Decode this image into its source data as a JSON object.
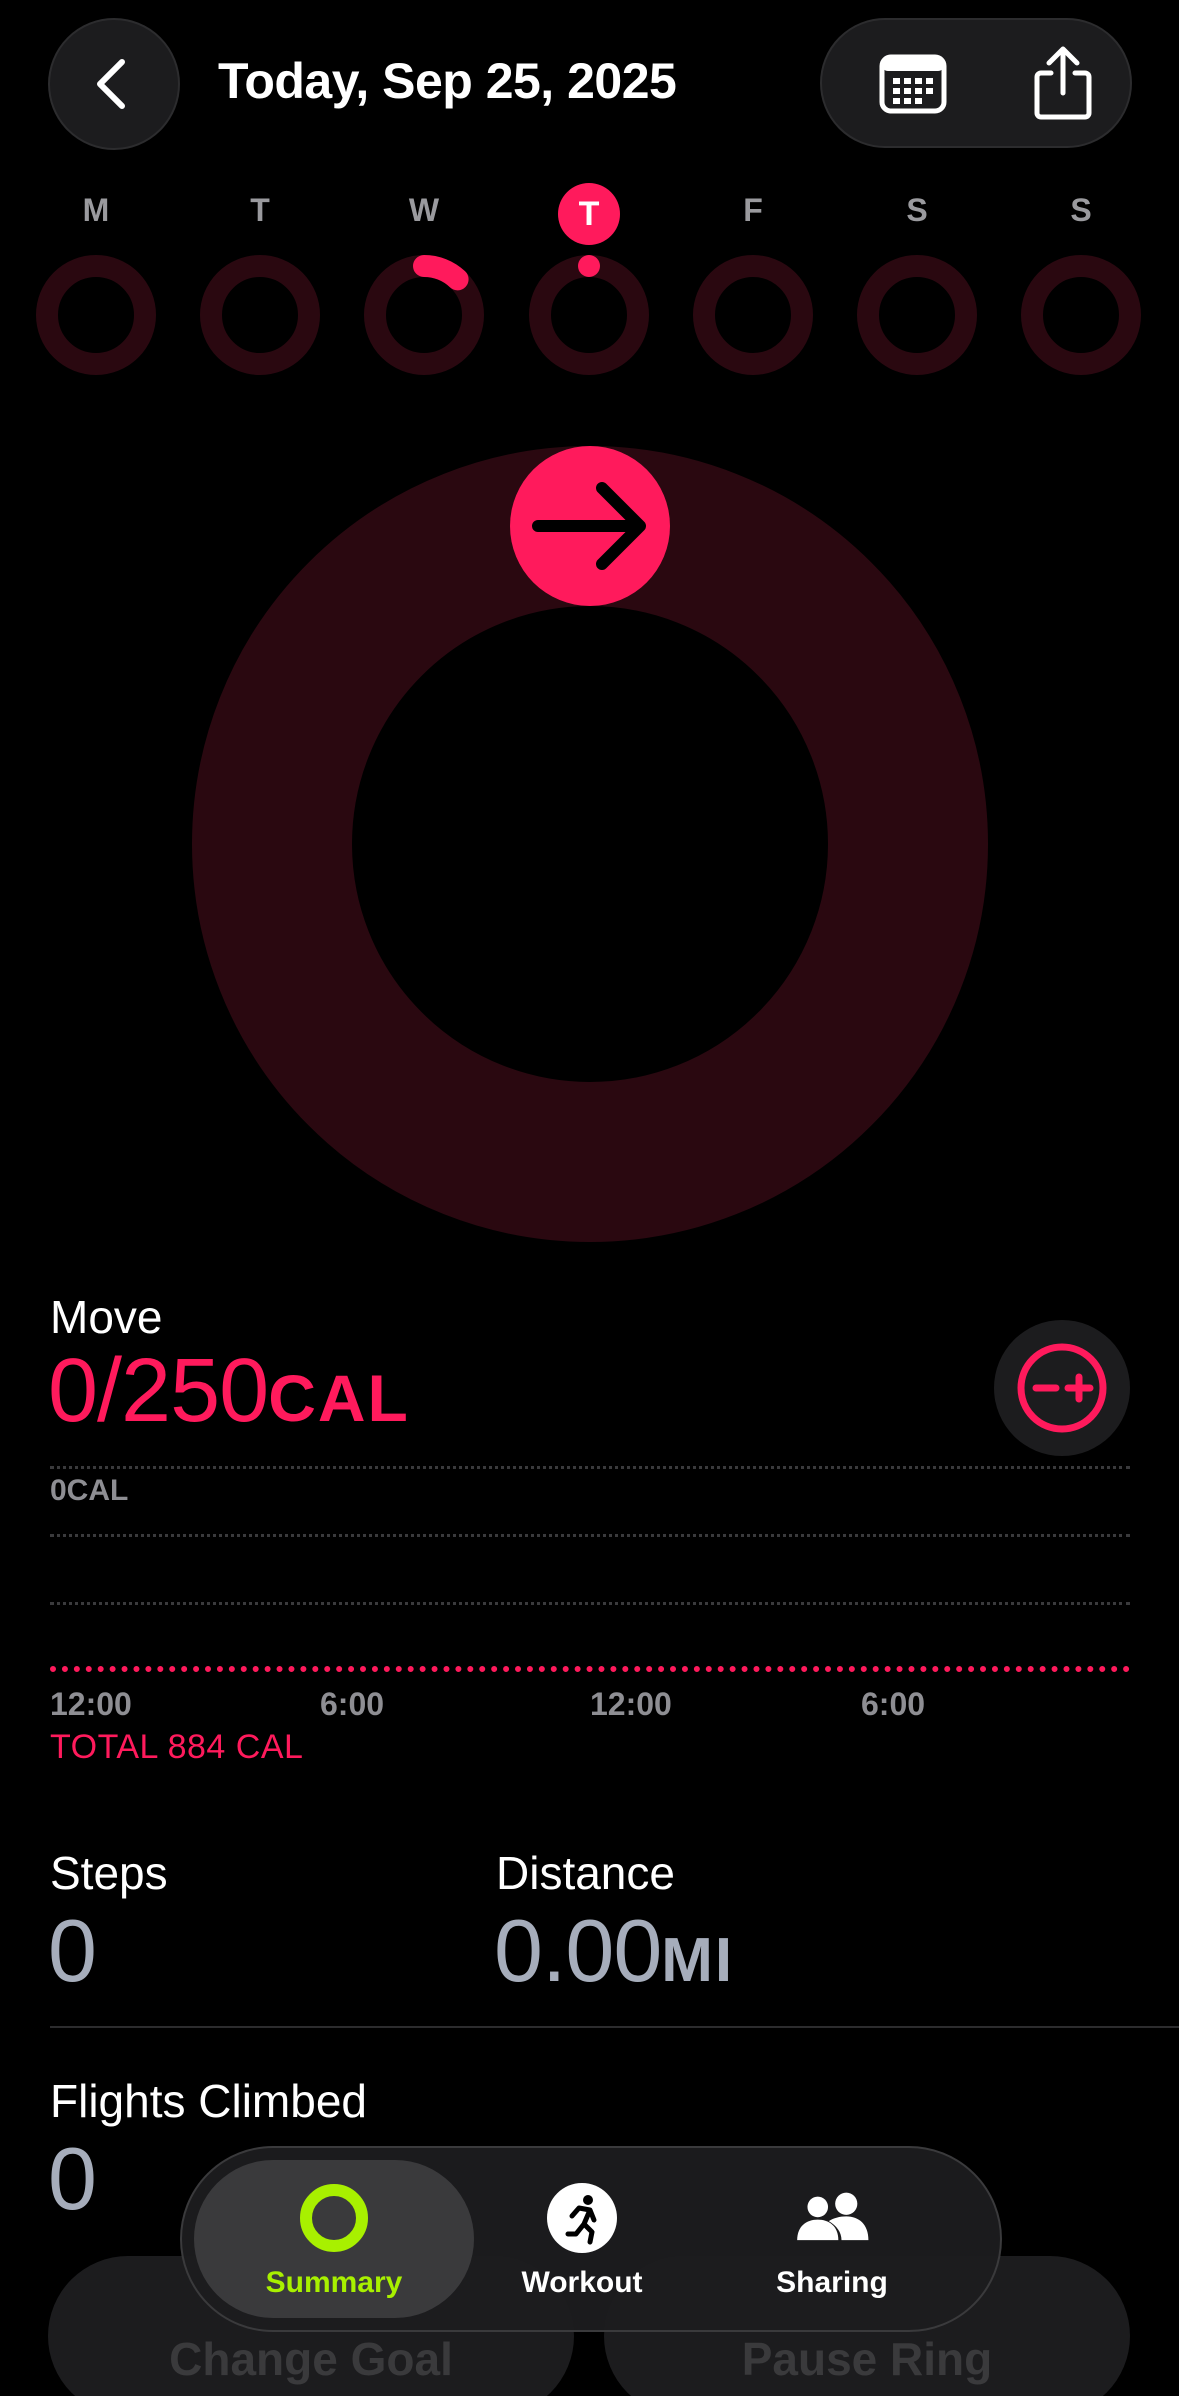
{
  "header": {
    "title": "Today, Sep 25, 2025",
    "back_icon": "chevron-left-icon",
    "calendar_icon": "calendar-icon",
    "share_icon": "share-icon"
  },
  "week": {
    "days": [
      {
        "letter": "M",
        "progress": 0
      },
      {
        "letter": "T",
        "progress": 0
      },
      {
        "letter": "W",
        "progress": 0.12
      },
      {
        "letter": "T",
        "progress": 0,
        "today": true
      },
      {
        "letter": "F",
        "progress": 0
      },
      {
        "letter": "S",
        "progress": 0
      },
      {
        "letter": "S",
        "progress": 0
      }
    ]
  },
  "move": {
    "label": "Move",
    "value": "0/250",
    "unit": "CAL",
    "progress": 0,
    "chart": {
      "y_label": "0CAL",
      "x_ticks": [
        "12:00",
        "6:00",
        "12:00",
        "6:00"
      ],
      "total": "TOTAL 884 CAL"
    }
  },
  "stats": {
    "steps": {
      "label": "Steps",
      "value": "0"
    },
    "distance": {
      "label": "Distance",
      "value": "0.00",
      "unit": "MI"
    },
    "flights": {
      "label": "Flights Climbed",
      "value": "0"
    }
  },
  "actions": {
    "change_goal": "Change Goal",
    "pause_ring": "Pause Ring"
  },
  "tabbar": {
    "summary": "Summary",
    "workout": "Workout",
    "sharing": "Sharing"
  },
  "colors": {
    "move": "#ff1a5c",
    "move_track": "#2a0810",
    "summary_accent": "#a8f000",
    "background": "#000000"
  }
}
